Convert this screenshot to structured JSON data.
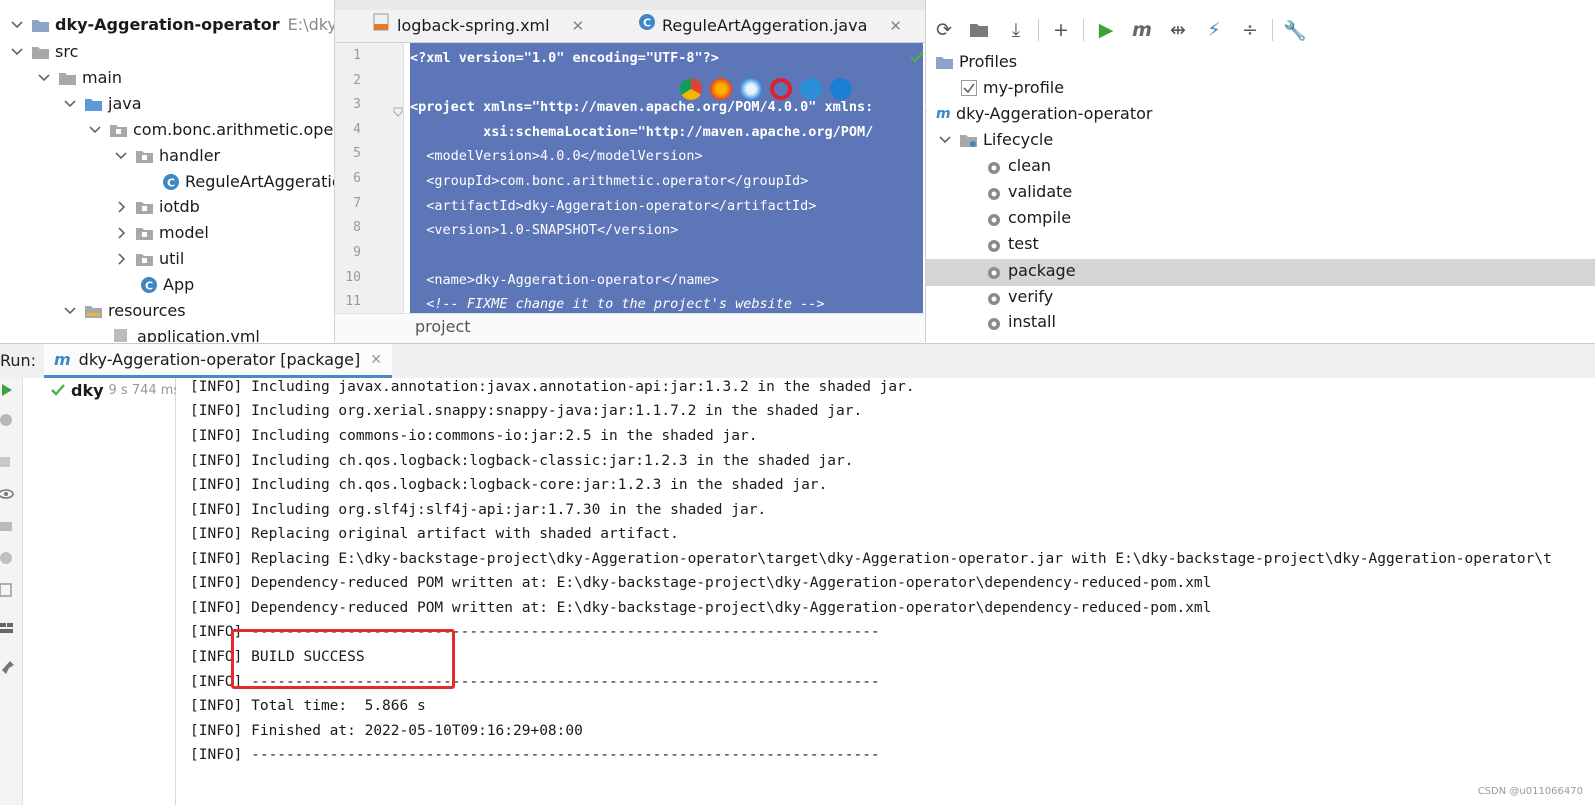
{
  "project": {
    "root_name": "dky-Aggeration-operator",
    "root_path": "E:\\dky-backst",
    "items": [
      {
        "label": "src"
      },
      {
        "label": "main"
      },
      {
        "label": "java"
      },
      {
        "label": "com.bonc.arithmetic.opera"
      },
      {
        "label": "handler"
      },
      {
        "label": "ReguleArtAggeratio"
      },
      {
        "label": "iotdb"
      },
      {
        "label": "model"
      },
      {
        "label": "util"
      },
      {
        "label": "App"
      },
      {
        "label": "resources"
      },
      {
        "label": "application.yml"
      }
    ]
  },
  "tabs": [
    {
      "label": "logback-spring.xml"
    },
    {
      "label": "ReguleArtAggeration.java"
    }
  ],
  "editor": {
    "line_numbers": [
      "1",
      "2",
      "3",
      "4",
      "5",
      "6",
      "7",
      "8",
      "9",
      "10",
      "11"
    ],
    "lines": [
      "<?xml version=\"1.0\" encoding=\"UTF-8\"?>",
      "",
      "<project xmlns=\"http://maven.apache.org/POM/4.0.0\" xmlns:",
      "         xsi:schemaLocation=\"http://maven.apache.org/POM/",
      "  <modelVersion>4.0.0</modelVersion>",
      "  <groupId>com.bonc.arithmetic.operator</groupId>",
      "  <artifactId>dky-Aggeration-operator</artifactId>",
      "  <version>1.0-SNAPSHOT</version>",
      "",
      "  <name>dky-Aggeration-operator</name>",
      "  <!-- FIXME change it to the project's website -->"
    ],
    "breadcrumb": "project"
  },
  "maven": {
    "profiles_label": "Profiles",
    "profile_item": "my-profile",
    "project_label": "dky-Aggeration-operator",
    "lifecycle_label": "Lifecycle",
    "phases": [
      "clean",
      "validate",
      "compile",
      "test",
      "package",
      "verify",
      "install"
    ],
    "selected_phase": "package"
  },
  "run": {
    "label": "Run:",
    "tab_label": "dky-Aggeration-operator [package]",
    "tree_name": "dky",
    "tree_time": "9 s 744 ms"
  },
  "console": {
    "lines": [
      "[INFO] Including javax.annotation:javax.annotation-api:jar:1.3.2 in the shaded jar.",
      "[INFO] Including org.xerial.snappy:snappy-java:jar:1.1.7.2 in the shaded jar.",
      "[INFO] Including commons-io:commons-io:jar:2.5 in the shaded jar.",
      "[INFO] Including ch.qos.logback:logback-classic:jar:1.2.3 in the shaded jar.",
      "[INFO] Including ch.qos.logback:logback-core:jar:1.2.3 in the shaded jar.",
      "[INFO] Including org.slf4j:slf4j-api:jar:1.7.30 in the shaded jar.",
      "[INFO] Replacing original artifact with shaded artifact.",
      "[INFO] Replacing E:\\dky-backstage-project\\dky-Aggeration-operator\\target\\dky-Aggeration-operator.jar with E:\\dky-backstage-project\\dky-Aggeration-operator\\t",
      "[INFO] Dependency-reduced POM written at: E:\\dky-backstage-project\\dky-Aggeration-operator\\dependency-reduced-pom.xml",
      "[INFO] Dependency-reduced POM written at: E:\\dky-backstage-project\\dky-Aggeration-operator\\dependency-reduced-pom.xml",
      "[INFO] ------------------------------------------------------------------------",
      "[INFO] BUILD SUCCESS",
      "[INFO] ------------------------------------------------------------------------",
      "[INFO] Total time:  5.866 s",
      "[INFO] Finished at: 2022-05-10T09:16:29+08:00",
      "[INFO] ------------------------------------------------------------------------"
    ]
  },
  "watermark": "CSDN @u011066470",
  "colors": {
    "selection": "#5d76b8",
    "accent": "#4a88c7",
    "success": "#4caf50",
    "highlight_box": "#e52a2a"
  },
  "icons": [
    "folder-icon",
    "package-icon",
    "java-class-icon",
    "gear-icon",
    "maven-icon",
    "refresh-icon",
    "run-icon",
    "wrench-icon",
    "checkmark-icon"
  ]
}
